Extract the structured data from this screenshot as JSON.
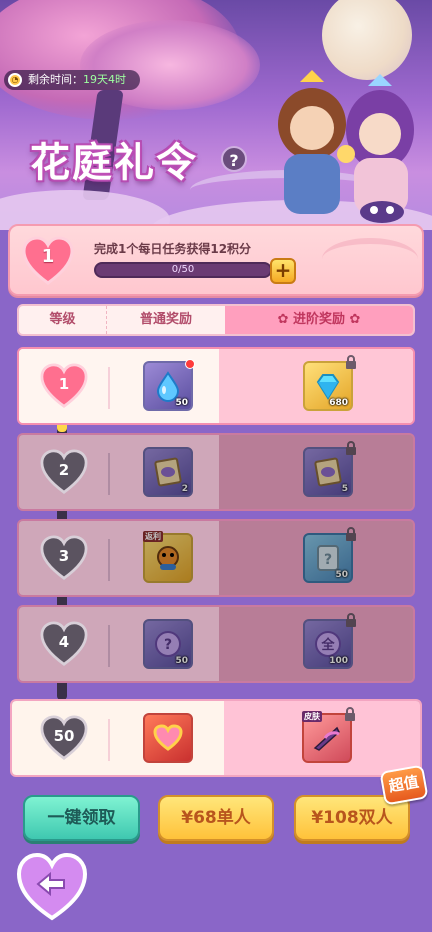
{
  "header": {
    "timer_label": "剩余时间：",
    "timer_value": "19天4时",
    "title": "花庭礼令",
    "help": "?"
  },
  "progress": {
    "level": "1",
    "task": "完成1个每日任务获得12积分",
    "value_text": "0/50",
    "fraction": 0.0,
    "plus": "+"
  },
  "tabs": {
    "level": "等级",
    "normal": "普通奖励",
    "advanced": "进阶奖励"
  },
  "rows": [
    {
      "level": "1",
      "normal": {
        "icon": "water-drop-icon",
        "qty": "50"
      },
      "advanced": {
        "icon": "diamond-icon",
        "qty": "680"
      }
    },
    {
      "level": "2",
      "normal": {
        "icon": "scroll-icon",
        "qty": "2"
      },
      "advanced": {
        "icon": "scroll-icon",
        "qty": "5"
      }
    },
    {
      "level": "3",
      "normal": {
        "icon": "tiger-pet-icon",
        "tag": "返利"
      },
      "advanced": {
        "icon": "mystery-scroll-icon",
        "qty": "50"
      }
    },
    {
      "level": "4",
      "normal": {
        "icon": "mystery-orb-icon",
        "qty": "50"
      },
      "advanced": {
        "icon": "all-orb-icon",
        "glyph": "全",
        "qty": "100"
      }
    },
    {
      "level": "50",
      "normal": {
        "icon": "heart-charm-icon"
      },
      "advanced": {
        "icon": "weapon-skin-icon",
        "tag": "皮肤"
      }
    }
  ],
  "buttons": {
    "claim_all": "一键领取",
    "buy_single": "¥68单人",
    "buy_double": "¥108双人",
    "value_badge": "超值"
  },
  "colors": {
    "accent_pink": "#ff9fbe",
    "gold": "#ffd84a",
    "teal": "#3fc8b0"
  }
}
